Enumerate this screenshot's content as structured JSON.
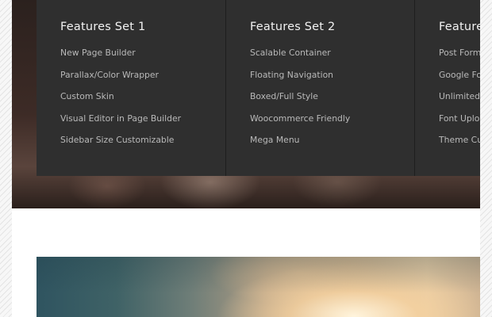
{
  "mega_menu": {
    "columns": [
      {
        "title": "Features Set 1",
        "items": [
          "New Page Builder",
          "Parallax/Color Wrapper",
          "Custom Skin",
          "Visual Editor in Page Builder",
          "Sidebar Size Customizable"
        ]
      },
      {
        "title": "Features Set 2",
        "items": [
          "Scalable Container",
          "Floating Navigation",
          "Boxed/Full Style",
          "Woocommerce Friendly",
          "Mega Menu"
        ]
      },
      {
        "title": "Feature",
        "items": [
          "Post Form",
          "Google Fo",
          "Unlimited",
          "Font Uplo",
          "Theme Cu"
        ]
      }
    ]
  },
  "colors": {
    "menu_background": "#2f2f2f",
    "menu_title": "#f2f2f2",
    "menu_item": "#b9b9b9"
  }
}
